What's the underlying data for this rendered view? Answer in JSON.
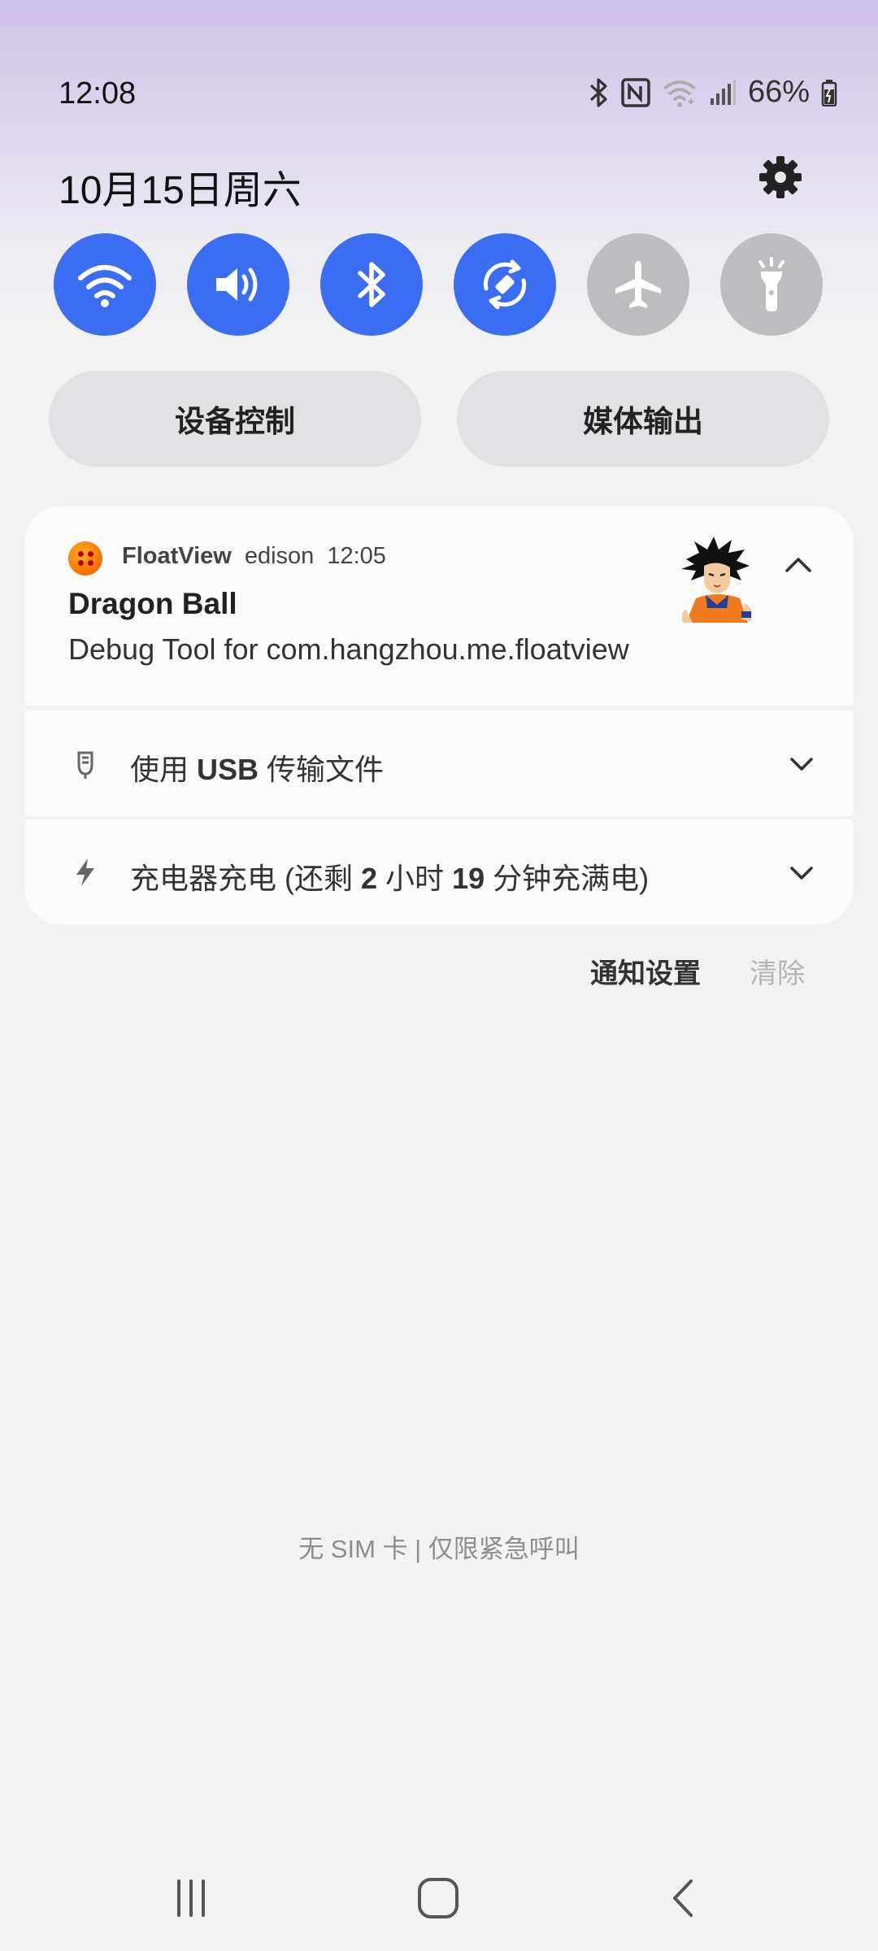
{
  "status_bar": {
    "time": "12:08",
    "battery_pct": "66%",
    "icons": [
      "bluetooth-icon",
      "nfc-icon",
      "wifi-icon",
      "signal-icon",
      "battery-icon"
    ]
  },
  "date": "10月15日周六",
  "quick_settings": {
    "tiles": [
      {
        "name": "wifi",
        "icon": "wifi-icon",
        "active": true
      },
      {
        "name": "sound",
        "icon": "volume-icon",
        "active": true
      },
      {
        "name": "bluetooth",
        "icon": "bluetooth-icon",
        "active": true
      },
      {
        "name": "auto-rotate",
        "icon": "rotate-icon",
        "active": true
      },
      {
        "name": "airplane-mode",
        "icon": "airplane-icon",
        "active": false
      },
      {
        "name": "flashlight",
        "icon": "flashlight-icon",
        "active": false
      }
    ],
    "device_control_label": "设备控制",
    "media_output_label": "媒体输出"
  },
  "notification": {
    "app_name": "FloatView",
    "user": "edison",
    "time": "12:05",
    "title": "Dragon Ball",
    "text": "Debug Tool for com.hangzhou.me.floatview"
  },
  "system_notifications": {
    "usb": {
      "prefix": "使用 ",
      "bold": "USB",
      "suffix": " 传输文件"
    },
    "charging": {
      "part1": "充电器充电 (还剩 ",
      "hours": "2",
      "part2": " 小时 ",
      "minutes": "19",
      "part3": " 分钟充满电)"
    }
  },
  "actions": {
    "notification_settings": "通知设置",
    "clear": "清除"
  },
  "sim_status": "无 SIM 卡 | 仅限紧急呼叫",
  "colors": {
    "accent": "#3a6df2",
    "tile_off": "#bdbdbf",
    "background": "#f2f2f3",
    "card": "#fafafa"
  }
}
